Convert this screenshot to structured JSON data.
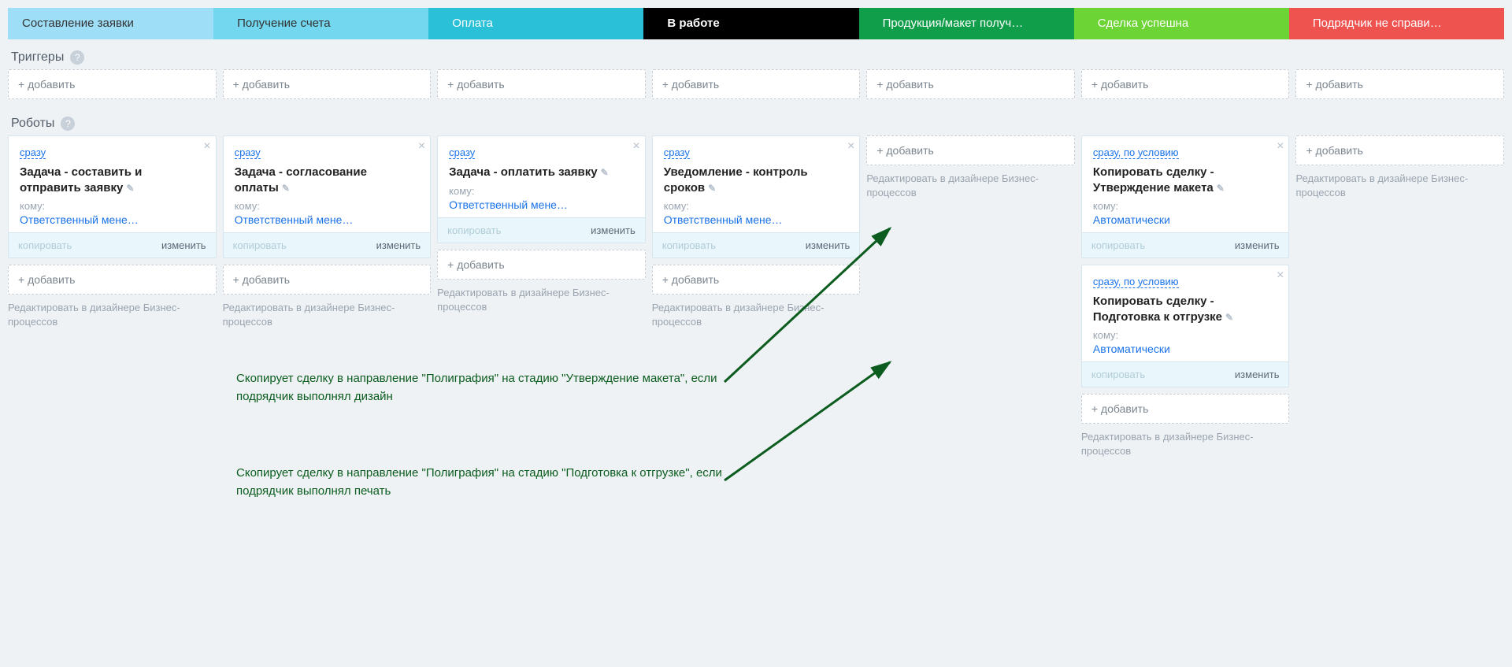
{
  "stages": [
    {
      "label": "Составление заявки",
      "cls": "s-cyan"
    },
    {
      "label": "Получение счета",
      "cls": "s-blue"
    },
    {
      "label": "Оплата",
      "cls": "s-teal"
    },
    {
      "label": "В работе",
      "cls": "s-black"
    },
    {
      "label": "Продукция/макет получ…",
      "cls": "s-green"
    },
    {
      "label": "Сделка успешна",
      "cls": "s-lime"
    },
    {
      "label": "Подрядчик не справи…",
      "cls": "s-red"
    }
  ],
  "labels": {
    "triggers": "Триггеры",
    "robots": "Роботы",
    "add": "+ добавить",
    "bpnote": "Редактировать в дизайнере Бизнес-процессов",
    "copy": "копировать",
    "change": "изменить",
    "whom": "кому:"
  },
  "cards": {
    "c0": {
      "trigger": "сразу",
      "title": "Задача - составить и отправить заявку",
      "who": "Ответственный мене…"
    },
    "c1": {
      "trigger": "сразу",
      "title": "Задача - согласование оплаты",
      "who": "Ответственный мене…"
    },
    "c2": {
      "trigger": "сразу",
      "title": "Задача - оплатить заявку",
      "who": "Ответственный мене…"
    },
    "c3": {
      "trigger": "сразу",
      "title": "Уведомление - контроль сроков",
      "who": "Ответственный мене…"
    },
    "c5a": {
      "trigger": "сразу, по условию",
      "title": "Копировать сделку - Утверждение макета",
      "who": "Автоматически"
    },
    "c5b": {
      "trigger": "сразу, по условию",
      "title": "Копировать сделку - Подготовка к отгрузке",
      "who": "Автоматически"
    }
  },
  "annotations": {
    "a1": "Скопирует сделку в направление \"Полиграфия\" на стадию \"Утверждение макета\", если подрядчик выполнял дизайн",
    "a2": "Скопирует сделку в направление \"Полиграфия\" на стадию \"Подготовка к отгрузке\", если подрядчик выполнял печать"
  }
}
